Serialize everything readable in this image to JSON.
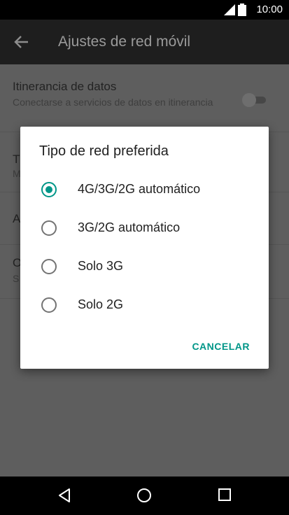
{
  "status_bar": {
    "time": "10:00"
  },
  "app_bar": {
    "title": "Ajustes de red móvil",
    "back_icon": "arrow-back-icon"
  },
  "settings": {
    "roaming": {
      "title": "Itinerancia de datos",
      "summary": "Conectarse a servicios de datos en itinerancia",
      "enabled": false
    },
    "row2": {
      "title_fragment": "T",
      "summary_fragment": "M"
    },
    "row3": {
      "title_fragment": "A"
    },
    "row4": {
      "title_fragment": "O",
      "summary_fragment": "S"
    }
  },
  "dialog": {
    "title": "Tipo de red preferida",
    "options": [
      {
        "label": "4G/3G/2G automático",
        "selected": true
      },
      {
        "label": "3G/2G automático",
        "selected": false
      },
      {
        "label": "Solo 3G",
        "selected": false
      },
      {
        "label": "Solo 2G",
        "selected": false
      }
    ],
    "cancel_label": "CANCELAR"
  },
  "colors": {
    "accent": "#009688",
    "scrim": "#5e5e5e",
    "app_bar": "#1e1e1e"
  },
  "nav_bar": {
    "icons": [
      "back-triangle-icon",
      "home-circle-icon",
      "recents-square-icon"
    ]
  }
}
